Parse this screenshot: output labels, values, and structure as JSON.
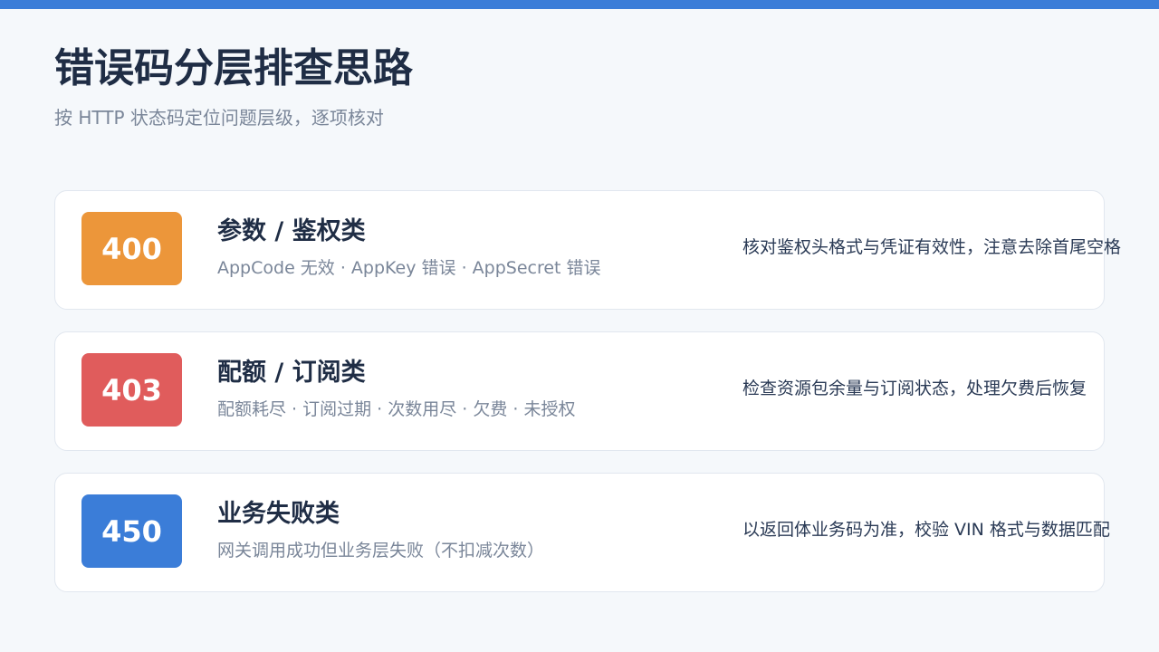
{
  "page": {
    "title": "错误码分层排查思路",
    "subtitle": "按 HTTP 状态码定位问题层级，逐项核对"
  },
  "theme": {
    "accent": "#3b7dd8",
    "background": "#f5f8fb"
  },
  "cards": [
    {
      "code": "400",
      "color": "#ec963a",
      "title": "参数 / 鉴权类",
      "description": "AppCode 无效 · AppKey 错误 · AppSecret 错误",
      "action": "核对鉴权头格式与凭证有效性，注意去除首尾空格"
    },
    {
      "code": "403",
      "color": "#e05c5c",
      "title": "配额 / 订阅类",
      "description": "配额耗尽 · 订阅过期 · 次数用尽 · 欠费 · 未授权",
      "action": "检查资源包余量与订阅状态，处理欠费后恢复"
    },
    {
      "code": "450",
      "color": "#3b7dd8",
      "title": "业务失败类",
      "description": "网关调用成功但业务层失败（不扣减次数）",
      "action": "以返回体业务码为准，校验 VIN 格式与数据匹配"
    }
  ]
}
